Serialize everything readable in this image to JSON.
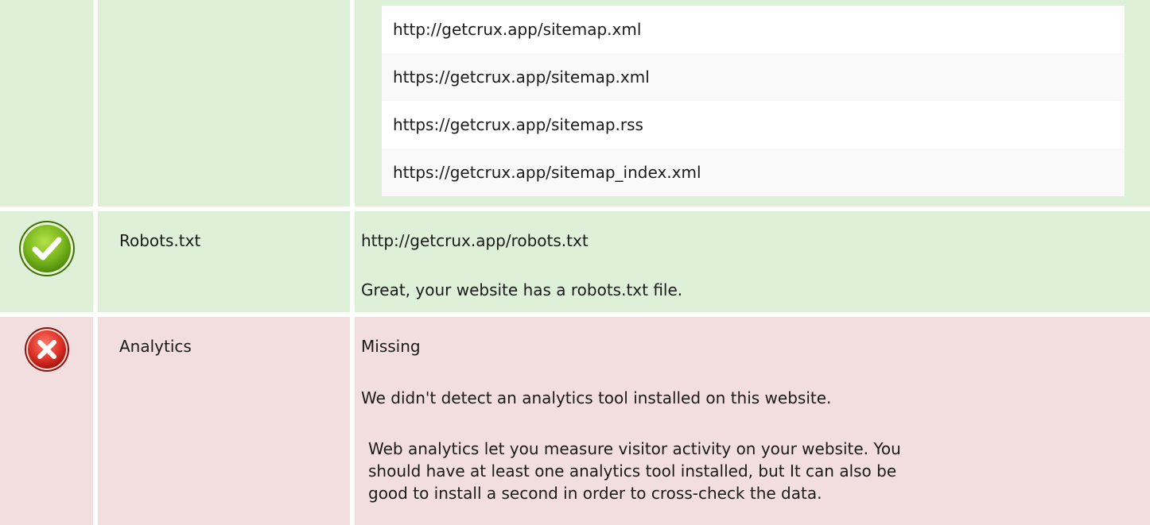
{
  "sitemaps": {
    "urls": [
      "http://getcrux.app/sitemap.xml",
      "https://getcrux.app/sitemap.xml",
      "https://getcrux.app/sitemap.rss",
      "https://getcrux.app/sitemap_index.xml"
    ]
  },
  "robots": {
    "label": "Robots.txt",
    "url": "http://getcrux.app/robots.txt",
    "message": "Great, your website has a robots.txt file.",
    "status": "pass",
    "icon": "check-circle-icon",
    "color": "#dff0d8"
  },
  "analytics": {
    "label": "Analytics",
    "status_text": "Missing",
    "message": "We didn't detect an analytics tool installed on this website.",
    "description": "Web analytics let you measure visitor activity on your website. You should have at least one analytics tool installed, but It can also be good to install a second in order to cross-check the data.",
    "status": "fail",
    "icon": "x-circle-icon",
    "color": "#f2dede"
  }
}
